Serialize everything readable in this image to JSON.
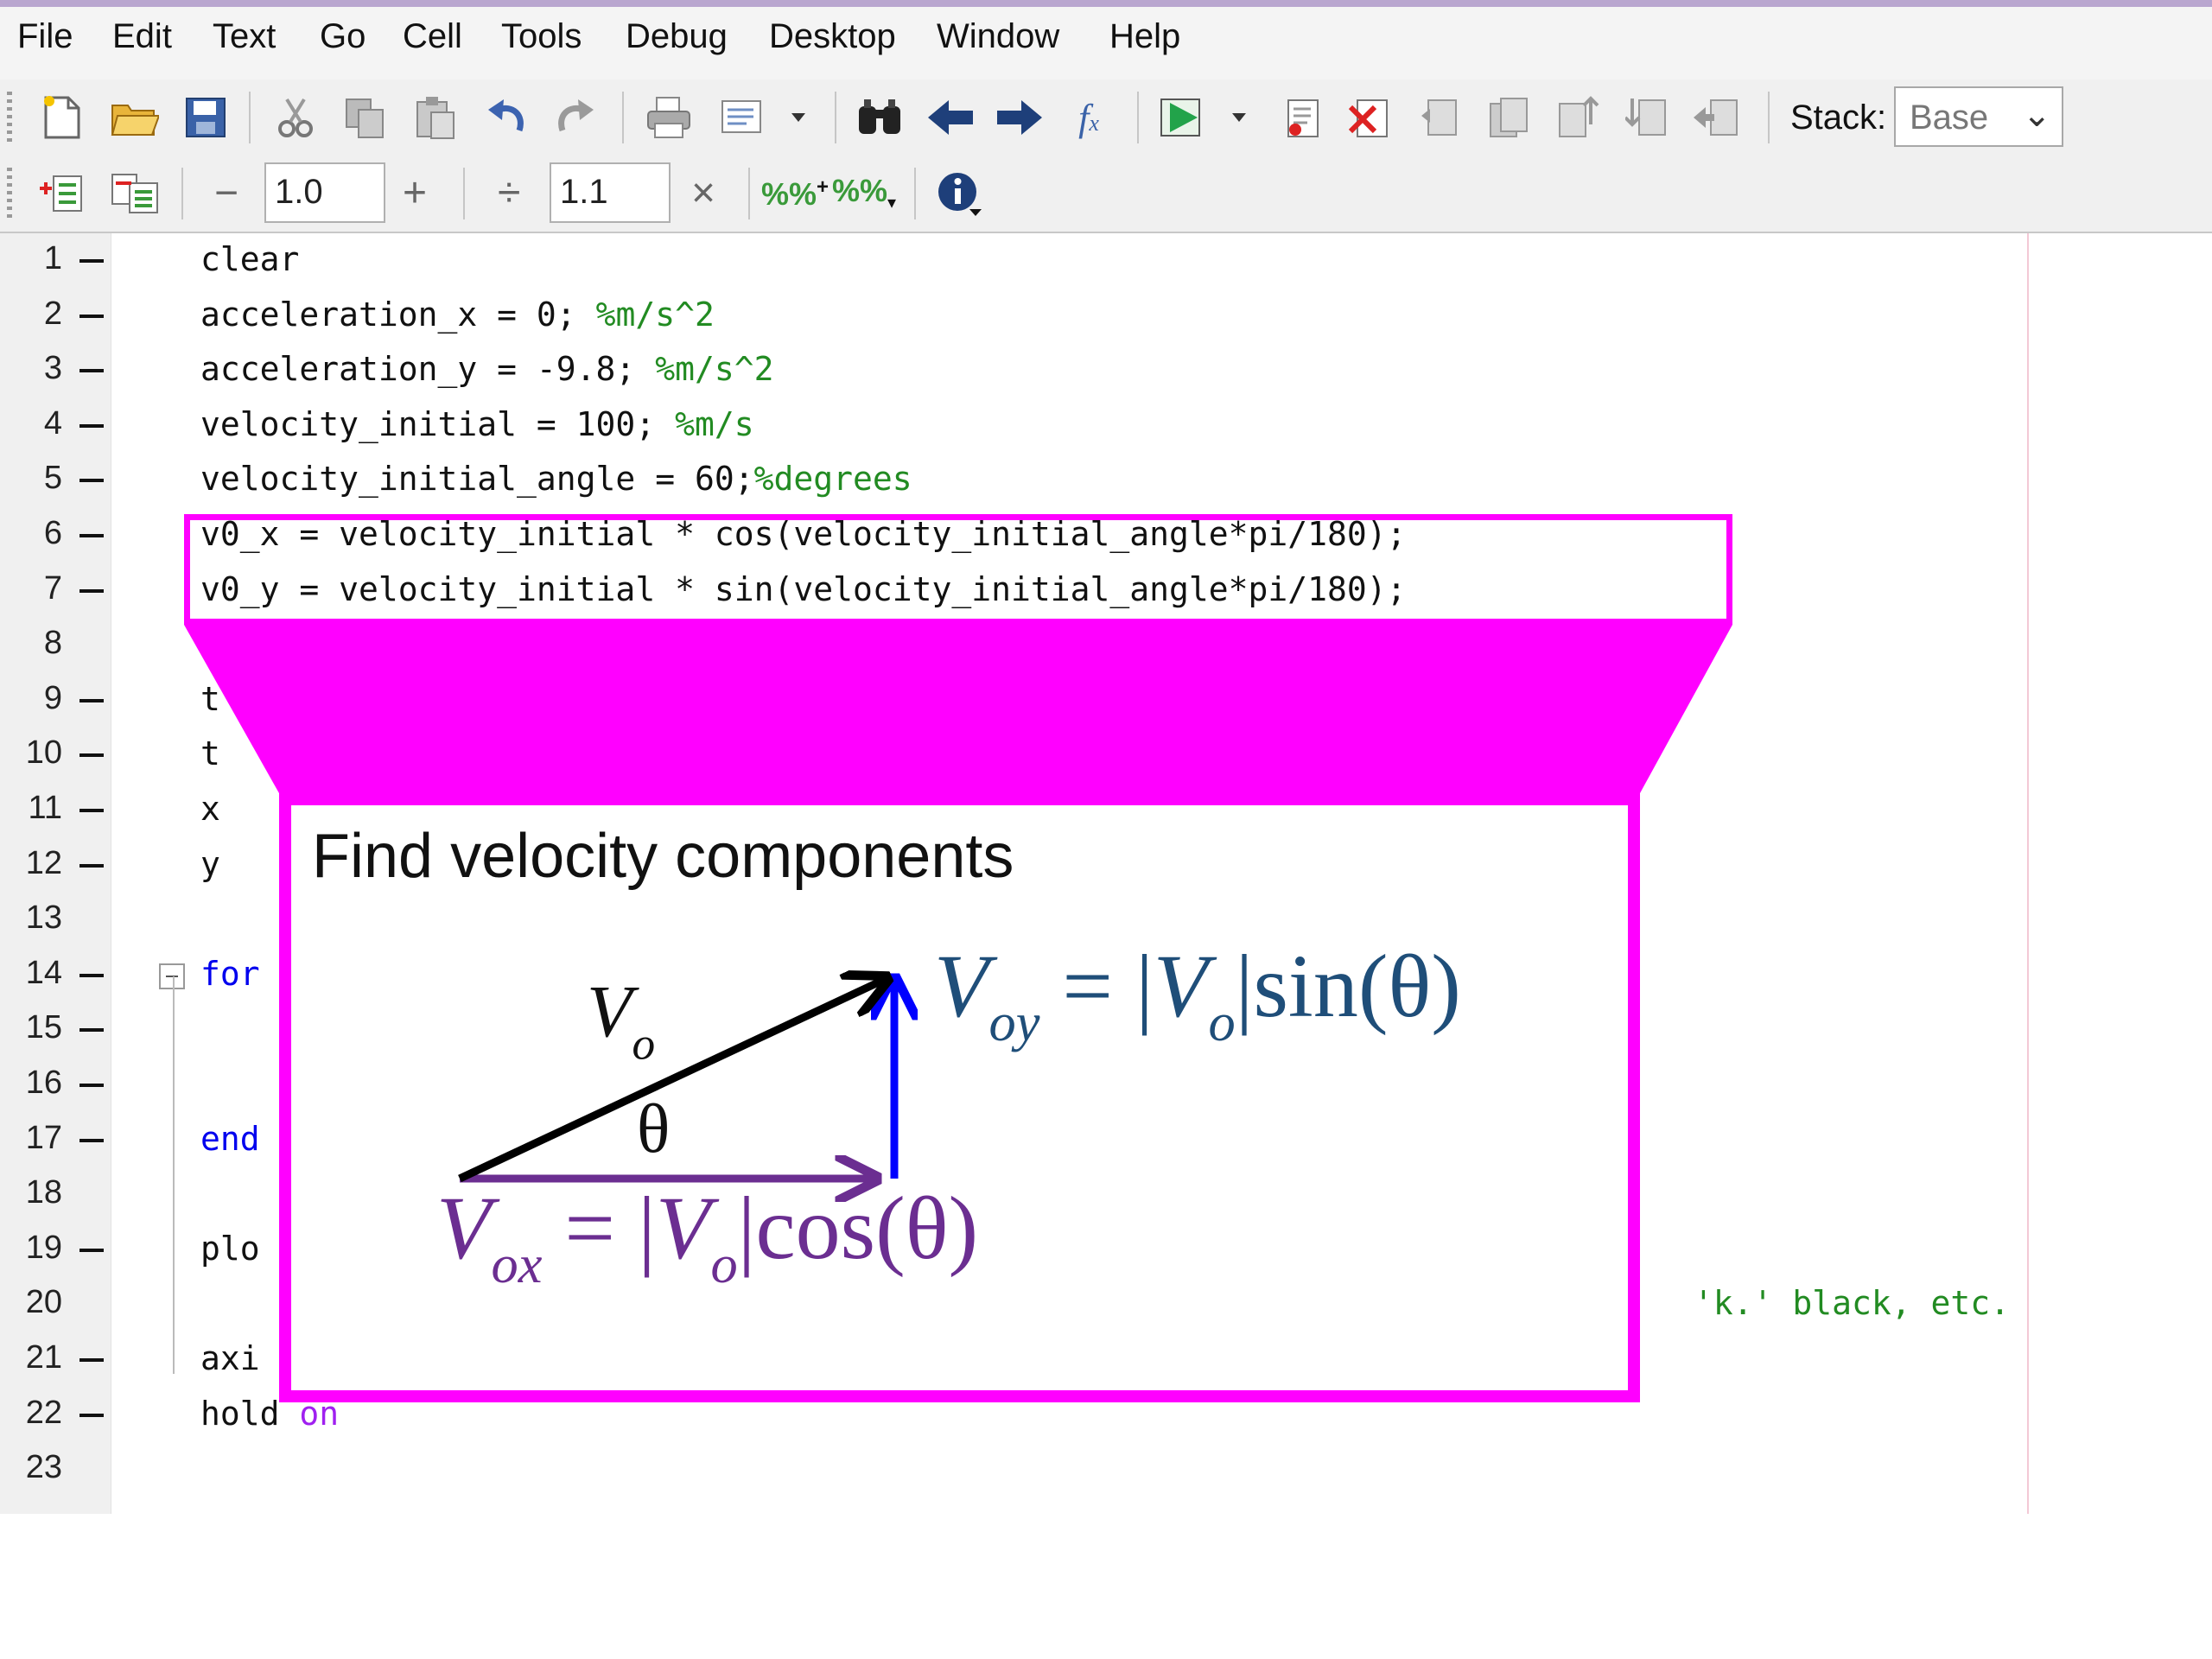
{
  "menu": [
    "File",
    "Edit",
    "Text",
    "Go",
    "Cell",
    "Tools",
    "Debug",
    "Desktop",
    "Window",
    "Help"
  ],
  "toolbar1": {
    "icons": [
      "new-file-icon",
      "open-folder-icon",
      "save-icon",
      "cut-icon",
      "copy-icon",
      "paste-icon",
      "undo-icon",
      "redo-icon",
      "print-icon",
      "page-setup-icon",
      "find-icon",
      "back-arrow-icon",
      "forward-arrow-icon",
      "function-icon",
      "run-icon",
      "set-breakpoint-icon",
      "clear-breakpoint-icon",
      "step-icon",
      "step-in-icon",
      "step-out-icon",
      "continue-icon",
      "exit-debug-icon"
    ],
    "stack_label": "Stack:",
    "stack_value": "Base"
  },
  "toolbar2": {
    "minus": "−",
    "value1": "1.0",
    "plus": "+",
    "divide": "÷",
    "value2": "1.1",
    "times": "×"
  },
  "editor": {
    "lines": [
      {
        "n": "1",
        "code": "clear",
        "comment": ""
      },
      {
        "n": "2",
        "code": "acceleration_x = 0; ",
        "comment": "%m/s^2"
      },
      {
        "n": "3",
        "code": "acceleration_y = -9.8; ",
        "comment": "%m/s^2"
      },
      {
        "n": "4",
        "code": "velocity_initial = 100; ",
        "comment": "%m/s"
      },
      {
        "n": "5",
        "code": "velocity_initial_angle = 60;",
        "comment": "%degrees"
      },
      {
        "n": "6",
        "code": "v0_x = velocity_initial * cos(velocity_initial_angle*pi/180);",
        "comment": ""
      },
      {
        "n": "7",
        "code": "v0_y = velocity_initial * sin(velocity_initial_angle*pi/180);",
        "comment": ""
      },
      {
        "n": "8",
        "code": "",
        "comment": ""
      },
      {
        "n": "9",
        "code": "t",
        "comment": ""
      },
      {
        "n": "10",
        "code": "t",
        "comment": ""
      },
      {
        "n": "11",
        "code": "x",
        "comment": ""
      },
      {
        "n": "12",
        "code": "y",
        "comment": ""
      },
      {
        "n": "13",
        "code": "",
        "comment": ""
      },
      {
        "n": "14",
        "code": "for",
        "comment": ""
      },
      {
        "n": "15",
        "code": "",
        "comment": ""
      },
      {
        "n": "16",
        "code": "",
        "comment": ""
      },
      {
        "n": "17",
        "code": "end",
        "comment": ""
      },
      {
        "n": "18",
        "code": "",
        "comment": ""
      },
      {
        "n": "19",
        "code": "plo",
        "comment": ""
      },
      {
        "n": "20",
        "code": "",
        "comment": "'k.' black, etc."
      },
      {
        "n": "21",
        "code": "axi",
        "comment": ""
      },
      {
        "n": "22",
        "code": "hold ",
        "comment": "on"
      },
      {
        "n": "23",
        "code": "",
        "comment": ""
      }
    ]
  },
  "callout": {
    "title": "Find velocity components",
    "vector_label": "V",
    "vector_sub": "o",
    "angle": "θ",
    "formula_y": {
      "lhs": "V",
      "lhs_sub": "oy",
      "eq": " = |",
      "v": "V",
      "v_sub": "o",
      "rest": "|sin(θ)"
    },
    "formula_x": {
      "lhs": "V",
      "lhs_sub": "ox",
      "eq": " = |",
      "v": "V",
      "v_sub": "o",
      "rest": "|cos(θ)"
    },
    "colors": {
      "highlight": "#ff00ff",
      "vy": "#0000ff",
      "vx": "#6b2e91",
      "hyp": "#000000"
    }
  }
}
